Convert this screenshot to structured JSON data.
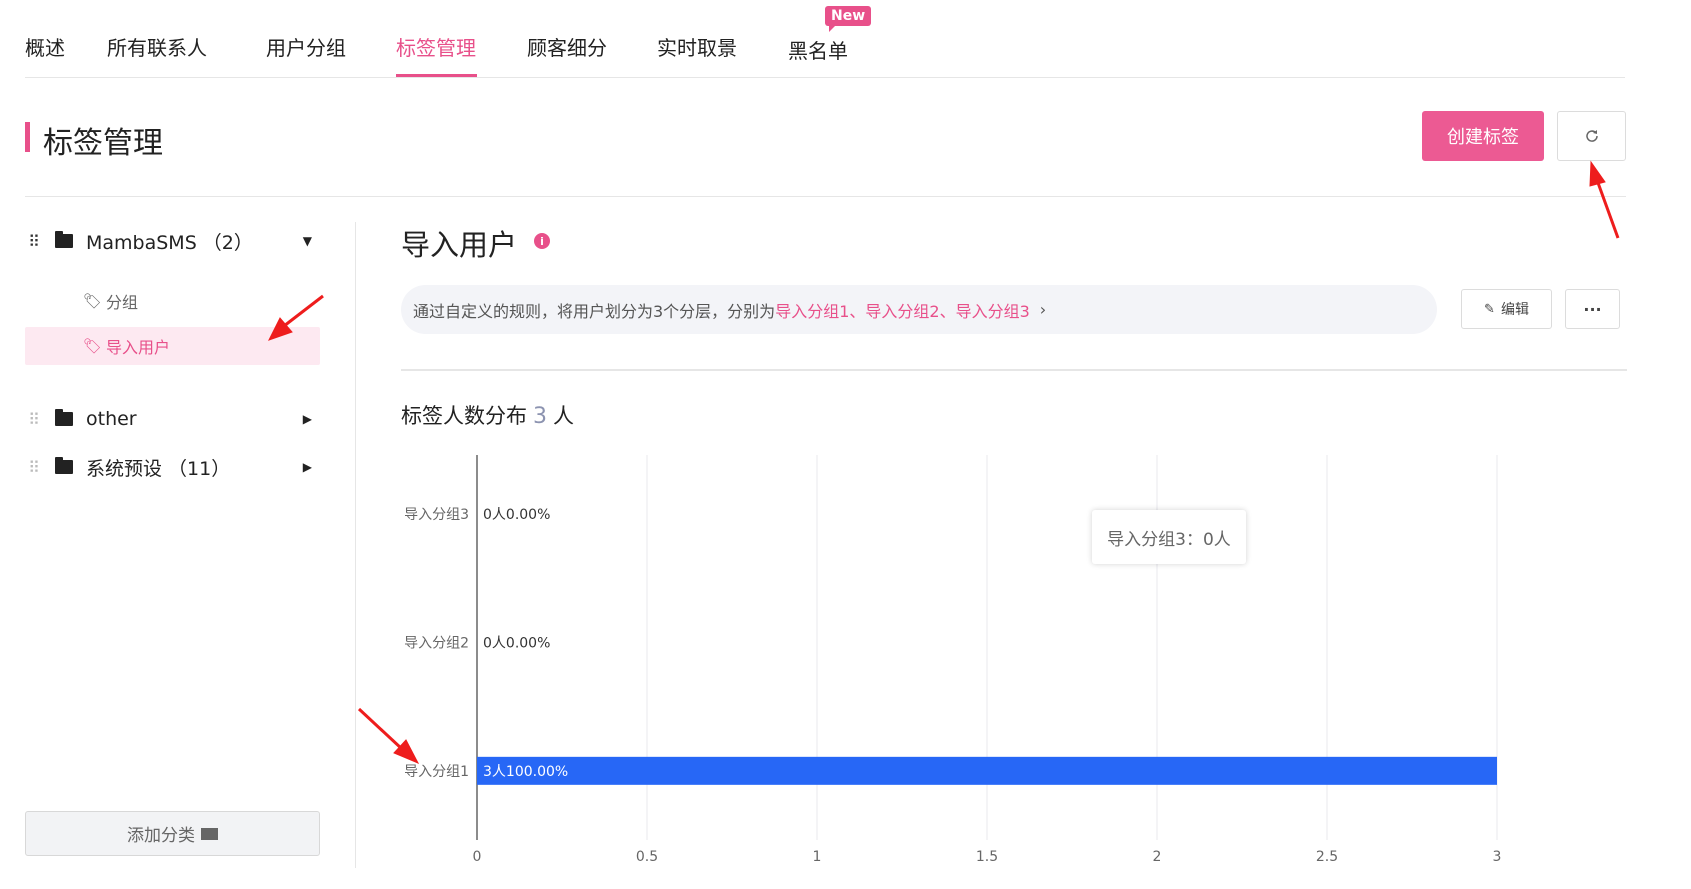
{
  "tabs": [
    {
      "label": "概述"
    },
    {
      "label": "所有联系人"
    },
    {
      "label": "用户分组"
    },
    {
      "label": "标签管理",
      "active": true
    },
    {
      "label": "顾客细分"
    },
    {
      "label": "实时取景"
    },
    {
      "label": "黑名单"
    }
  ],
  "new_badge": "New",
  "page": {
    "title": "标签管理",
    "create_button": "创建标签",
    "refresh_icon": "refresh-icon"
  },
  "sidebar": {
    "folders": [
      {
        "label": "MambaSMS （2）",
        "expanded": true,
        "items": [
          {
            "label": "分组"
          },
          {
            "label": "导入用户",
            "active": true
          }
        ]
      },
      {
        "label": "other",
        "expanded": false
      },
      {
        "label": "系统预设 （11）",
        "expanded": false
      }
    ],
    "add_category": "添加分类"
  },
  "main": {
    "title": "导入用户",
    "rule": {
      "prefix": "通过自定义的规则，将用户划分为3个分层，分别为 ",
      "links": [
        "导入分组1",
        "导入分组2",
        "导入分组3"
      ],
      "separator": "、 "
    },
    "edit_button": "编辑",
    "more_button": "···",
    "distribution_title": "标签人数分布",
    "distribution_count": "3",
    "distribution_unit": "人"
  },
  "tooltip": "导入分组3：0人",
  "colors": {
    "accent": "#e8508a",
    "bar": "#2767f6"
  },
  "chart_data": {
    "type": "bar",
    "orientation": "horizontal",
    "categories": [
      "导入分组3",
      "导入分组2",
      "导入分组1"
    ],
    "values": [
      0,
      0,
      3
    ],
    "data_labels": [
      "0人0.00%",
      "0人0.00%",
      "3人100.00%"
    ],
    "xlim": [
      0,
      3
    ],
    "x_ticks": [
      "0",
      "0.5",
      "1",
      "1.5",
      "2",
      "2.5",
      "3"
    ],
    "grid": true
  }
}
